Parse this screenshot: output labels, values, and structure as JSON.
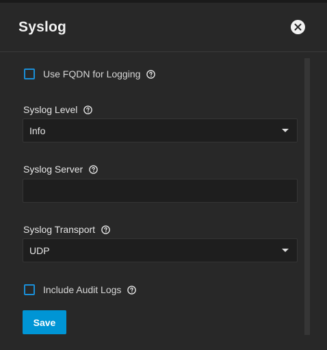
{
  "dialog": {
    "title": "Syslog"
  },
  "form": {
    "fqdn_label": "Use FQDN for Logging",
    "fqdn_checked": false,
    "level_label": "Syslog Level",
    "level_value": "Info",
    "server_label": "Syslog Server",
    "server_value": "",
    "transport_label": "Syslog Transport",
    "transport_value": "UDP",
    "audit_label": "Include Audit Logs",
    "audit_checked": false,
    "save_label": "Save"
  },
  "icons": {
    "close": "close-icon",
    "help": "help-circle-icon",
    "dropdown": "chevron-down-icon"
  },
  "colors": {
    "accent": "#0095d5",
    "checkbox_border": "#1a8fd8",
    "background": "#282828",
    "field_background": "#1e1e1e"
  }
}
